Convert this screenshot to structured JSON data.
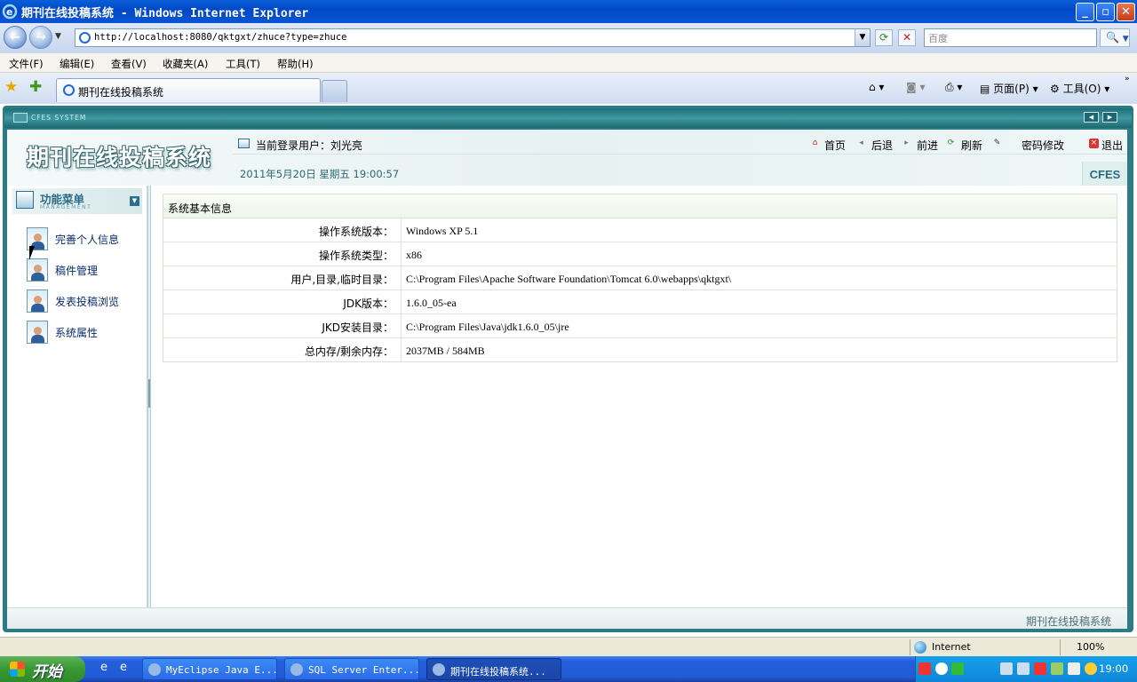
{
  "window": {
    "title": "期刊在线投稿系统 - Windows Internet Explorer"
  },
  "address": {
    "url": "http://localhost:8080/qktgxt/zhuce?type=zhuce"
  },
  "search": {
    "placeholder": "百度"
  },
  "menu": [
    "文件(F)",
    "编辑(E)",
    "查看(V)",
    "收藏夹(A)",
    "工具(T)",
    "帮助(H)"
  ],
  "tab": {
    "label": "期刊在线投稿系统"
  },
  "commandbar": {
    "page": "页面(P)",
    "tools": "工具(O)"
  },
  "cfes_bar": {
    "label": "CFES SYSTEM"
  },
  "header": {
    "logo": "期刊在线投稿系统",
    "user_label": "当前登录用户：刘光亮",
    "links": {
      "home": "首页",
      "back": "后退",
      "forward": "前进",
      "refresh": "刷新",
      "password": "密码修改",
      "logout": "退出"
    },
    "date": "2011年5月20日  星期五  19:00:57",
    "brand": "CFES"
  },
  "sidebar": {
    "title": "功能菜单",
    "subtitle": "MANAGEMENT",
    "items": [
      "完善个人信息",
      "稿件管理",
      "发表投稿浏览",
      "系统属性"
    ]
  },
  "sysinfo": {
    "caption": "系统基本信息",
    "rows": [
      {
        "key": "操作系统版本：",
        "value": "Windows XP  5.1"
      },
      {
        "key": "操作系统类型：",
        "value": "x86"
      },
      {
        "key": "用户,目录,临时目录：",
        "value": "C:\\Program Files\\Apache Software Foundation\\Tomcat 6.0\\webapps\\qktgxt\\"
      },
      {
        "key": "JDK版本：",
        "value": "1.6.0_05-ea"
      },
      {
        "key": "JKD安装目录：",
        "value": "C:\\Program Files\\Java\\jdk1.6.0_05\\jre"
      },
      {
        "key": "总内存/剩余内存：",
        "value": "2037MB  /  584MB"
      }
    ]
  },
  "footer": {
    "text": "期刊在线投稿系统"
  },
  "status": {
    "zone": "Internet",
    "zoom": "100%"
  },
  "taskbar": {
    "start": "开始",
    "buttons": [
      "MyEclipse Java E...",
      "SQL Server Enter...",
      "期刊在线投稿系统..."
    ],
    "clock": "19:00"
  }
}
